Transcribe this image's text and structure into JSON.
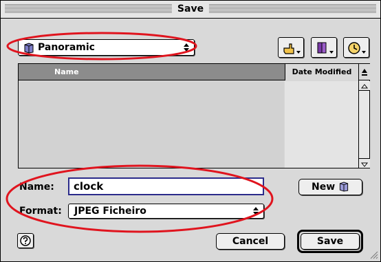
{
  "window": {
    "title": "Save"
  },
  "location_popup": {
    "selected": "Panoramic"
  },
  "toolbar": {
    "buttons": [
      {
        "name": "go-up-folder",
        "icon": "pointing-hand-icon"
      },
      {
        "name": "shortcuts",
        "icon": "book-icon"
      },
      {
        "name": "recent-items",
        "icon": "clock-icon"
      }
    ]
  },
  "file_list": {
    "columns": [
      "Name",
      "Date Modified"
    ],
    "rows": []
  },
  "name_field": {
    "label": "Name:",
    "value": "clock"
  },
  "new_button": {
    "label": "New"
  },
  "format_popup": {
    "label": "Format:",
    "selected": "JPEG Ficheiro"
  },
  "help_button": {
    "icon": "help-icon"
  },
  "cancel_button": {
    "label": "Cancel"
  },
  "save_button": {
    "label": "Save"
  },
  "colors": {
    "annotation": "#e0141e",
    "field_border": "#2a2a8a",
    "header": "#8c8c8c"
  }
}
